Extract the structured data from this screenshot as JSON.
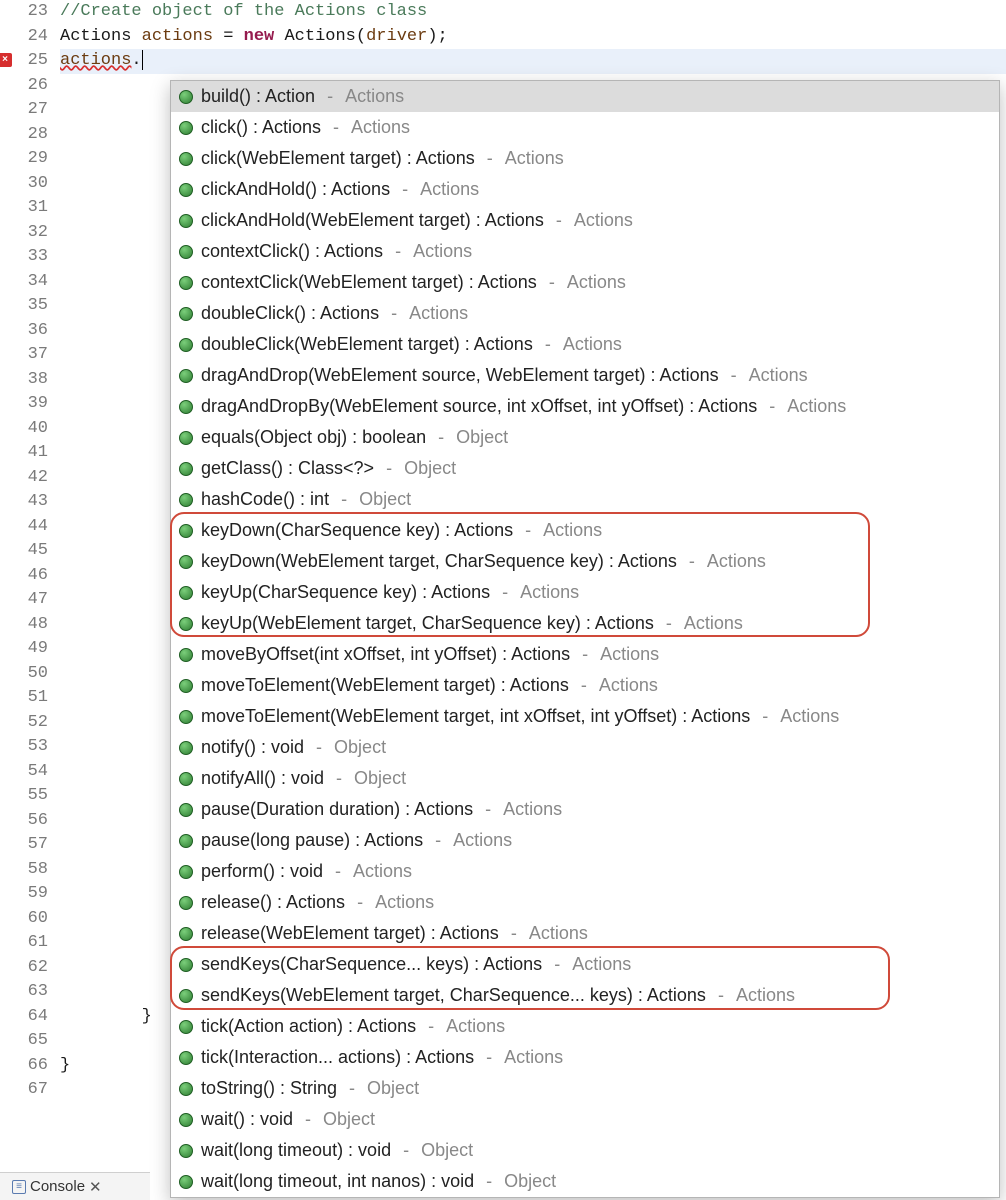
{
  "gutter": {
    "start": 23,
    "end": 67,
    "error_marker_line": 25
  },
  "code": {
    "line23_comment": "//Create object of the Actions class",
    "line24_type1": "Actions",
    "line24_var": "actions",
    "line24_eq": " = ",
    "line24_new": "new",
    "line24_type2": " Actions",
    "line24_open": "(",
    "line24_arg": "driver",
    "line24_close": ");",
    "line25_obj": "actions",
    "line25_dot": ".",
    "line64_brace": "        }",
    "line66_brace": "}"
  },
  "popup": {
    "items": [
      {
        "sig": "build() : Action",
        "origin": "Actions",
        "selected": true
      },
      {
        "sig": "click() : Actions",
        "origin": "Actions"
      },
      {
        "sig": "click(WebElement target) : Actions",
        "origin": "Actions"
      },
      {
        "sig": "clickAndHold() : Actions",
        "origin": "Actions"
      },
      {
        "sig": "clickAndHold(WebElement target) : Actions",
        "origin": "Actions"
      },
      {
        "sig": "contextClick() : Actions",
        "origin": "Actions"
      },
      {
        "sig": "contextClick(WebElement target) : Actions",
        "origin": "Actions"
      },
      {
        "sig": "doubleClick() : Actions",
        "origin": "Actions"
      },
      {
        "sig": "doubleClick(WebElement target) : Actions",
        "origin": "Actions"
      },
      {
        "sig": "dragAndDrop(WebElement source, WebElement target) : Actions",
        "origin": "Actions"
      },
      {
        "sig": "dragAndDropBy(WebElement source, int xOffset, int yOffset) : Actions",
        "origin": "Actions"
      },
      {
        "sig": "equals(Object obj) : boolean",
        "origin": "Object"
      },
      {
        "sig": "getClass() : Class<?>",
        "origin": "Object"
      },
      {
        "sig": "hashCode() : int",
        "origin": "Object"
      },
      {
        "sig": "keyDown(CharSequence key) : Actions",
        "origin": "Actions"
      },
      {
        "sig": "keyDown(WebElement target, CharSequence key) : Actions",
        "origin": "Actions"
      },
      {
        "sig": "keyUp(CharSequence key) : Actions",
        "origin": "Actions"
      },
      {
        "sig": "keyUp(WebElement target, CharSequence key) : Actions",
        "origin": "Actions"
      },
      {
        "sig": "moveByOffset(int xOffset, int yOffset) : Actions",
        "origin": "Actions"
      },
      {
        "sig": "moveToElement(WebElement target) : Actions",
        "origin": "Actions"
      },
      {
        "sig": "moveToElement(WebElement target, int xOffset, int yOffset) : Actions",
        "origin": "Actions"
      },
      {
        "sig": "notify() : void",
        "origin": "Object"
      },
      {
        "sig": "notifyAll() : void",
        "origin": "Object"
      },
      {
        "sig": "pause(Duration duration) : Actions",
        "origin": "Actions"
      },
      {
        "sig": "pause(long pause) : Actions",
        "origin": "Actions"
      },
      {
        "sig": "perform() : void",
        "origin": "Actions"
      },
      {
        "sig": "release() : Actions",
        "origin": "Actions"
      },
      {
        "sig": "release(WebElement target) : Actions",
        "origin": "Actions"
      },
      {
        "sig": "sendKeys(CharSequence... keys) : Actions",
        "origin": "Actions"
      },
      {
        "sig": "sendKeys(WebElement target, CharSequence... keys) : Actions",
        "origin": "Actions"
      },
      {
        "sig": "tick(Action action) : Actions",
        "origin": "Actions"
      },
      {
        "sig": "tick(Interaction... actions) : Actions",
        "origin": "Actions"
      },
      {
        "sig": "toString() : String",
        "origin": "Object"
      },
      {
        "sig": "wait() : void",
        "origin": "Object"
      },
      {
        "sig": "wait(long timeout) : void",
        "origin": "Object"
      },
      {
        "sig": "wait(long timeout, int nanos) : void",
        "origin": "Object"
      }
    ]
  },
  "bottom": {
    "console_label": "Console",
    "close_glyph": "✕"
  }
}
